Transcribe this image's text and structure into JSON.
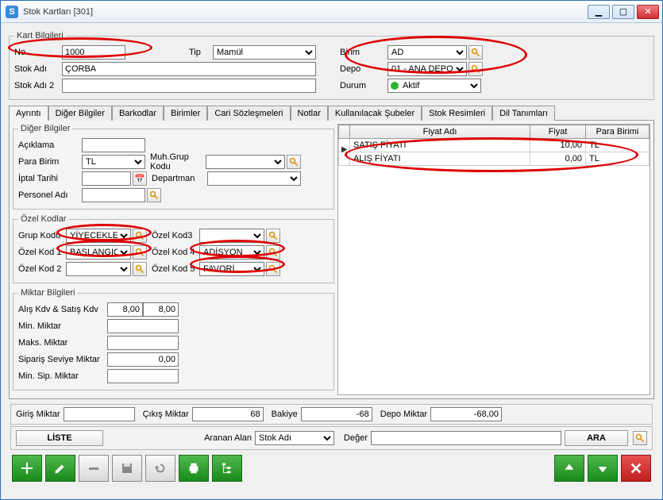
{
  "window": {
    "title": "Stok Kartları  [301]"
  },
  "kart": {
    "legend": "Kart Bilgileri",
    "no_label": "No",
    "no": "1000",
    "tip_label": "Tip",
    "tip": "Mamül",
    "birim_label": "Birim",
    "birim": "AD",
    "stokadi_label": "Stok Adı",
    "stokadi": "ÇORBA",
    "depo_label": "Depo",
    "depo": "01 - ANA DEPO",
    "stokadi2_label": "Stok Adı 2",
    "stokadi2": "",
    "durum_label": "Durum",
    "durum": "Aktif"
  },
  "tabs": [
    "Ayrıntı",
    "Diğer Bilgiler",
    "Barkodlar",
    "Birimler",
    "Cari Sözleşmeleri",
    "Notlar",
    "Kullanılacak Şubeler",
    "Stok Resimleri",
    "Dil Tanımları"
  ],
  "diger": {
    "legend": "Diğer Bilgiler",
    "aciklama_label": "Açıklama",
    "aciklama": "",
    "parabirim_label": "Para Birim",
    "parabirim": "TL",
    "muhgrup_label": "Muh.Grup Kodu",
    "muhgrup": "",
    "iptal_label": "İptal Tarihi",
    "iptal": "",
    "departman_label": "Departman",
    "departman": "",
    "personel_label": "Personel Adı",
    "personel": ""
  },
  "ozel": {
    "legend": "Özel Kodlar",
    "grup_label": "Grup Kodu",
    "grup": "YİYECEKLER",
    "k1_label": "Özel Kod 1",
    "k1": "BAŞLANGIÇLAR",
    "k2_label": "Özel Kod 2",
    "k2": "",
    "k3_label": "Özel Kod3",
    "k3": "",
    "k4_label": "Özel Kod 4",
    "k4": "ADİSYON",
    "k5_label": "Özel Kod 5",
    "k5": "FAVORİ"
  },
  "miktar": {
    "legend": "Miktar Bilgileri",
    "kdv_label": "Alış Kdv & Satış Kdv",
    "kdv_alis": "8,00",
    "kdv_satis": "8,00",
    "min_label": "Min. Miktar",
    "min": "",
    "maks_label": "Maks. Miktar",
    "maks": "",
    "siparis_label": "Sipariş Seviye Miktar",
    "siparis": "0,00",
    "minsip_label": "Min. Sip. Miktar",
    "minsip": ""
  },
  "prices": {
    "headers": [
      "Fiyat Adı",
      "Fiyat",
      "Para Birimi"
    ],
    "rows": [
      {
        "ad": "SATIŞ FİYATI",
        "fiyat": "10,00",
        "pb": "TL"
      },
      {
        "ad": "ALIŞ FİYATI",
        "fiyat": "0,00",
        "pb": "TL"
      }
    ]
  },
  "footer": {
    "giris_label": "Giriş Miktar",
    "giris": "",
    "cikis_label": "Çıkış Miktar",
    "cikis": "68",
    "bakiye_label": "Bakiye",
    "bakiye": "-68",
    "depo_label": "Depo Miktar",
    "depo": "-68,00"
  },
  "search": {
    "liste": "LİSTE",
    "aranan_label": "Aranan Alan",
    "aranan": "Stok Adı",
    "deger_label": "Değer",
    "deger": "",
    "ara": "ARA"
  }
}
